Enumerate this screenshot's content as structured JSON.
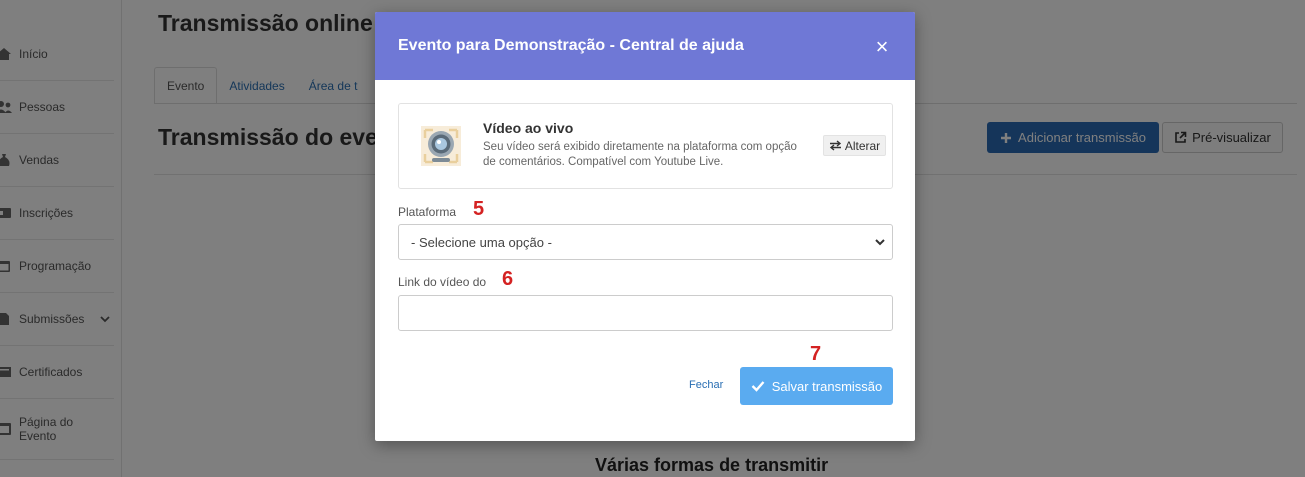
{
  "sidebar": {
    "items": [
      {
        "label": "Início",
        "icon": "home-icon"
      },
      {
        "label": "Pessoas",
        "icon": "people-icon"
      },
      {
        "label": "Vendas",
        "icon": "money-bag-icon"
      },
      {
        "label": "Inscrições",
        "icon": "id-card-icon"
      },
      {
        "label": "Programação",
        "icon": "calendar-icon"
      },
      {
        "label": "Submissões",
        "icon": "document-icon"
      },
      {
        "label": "Certificados",
        "icon": "certificate-icon"
      },
      {
        "label": "Página do Evento",
        "icon": "page-icon"
      }
    ]
  },
  "page": {
    "title": "Transmissão online",
    "tabs": [
      "Evento",
      "Atividades",
      "Área de t"
    ],
    "section_title": "Transmissão do evento",
    "add_button": "Adicionar transmissão",
    "preview_button": "Pré-visualizar",
    "bottom_heading": "Várias formas de transmitir"
  },
  "modal": {
    "title": "Evento para Demonstração - Central de ajuda",
    "close_symbol": "×",
    "type_card": {
      "title": "Vídeo ao vivo",
      "description": "Seu vídeo será exibido diretamente na plataforma com opção de comentários. Compatível com Youtube Live.",
      "change_button": "Alterar"
    },
    "platform": {
      "label": "Plataforma",
      "step": "5",
      "selected": "- Selecione uma opção -"
    },
    "video_link": {
      "label": "Link do vídeo do",
      "step": "6",
      "value": ""
    },
    "save_step": "7",
    "close_link": "Fechar",
    "save_button": "Salvar transmissão"
  },
  "colors": {
    "modal_header": "#6f78d6",
    "primary_button": "#2a6bb5",
    "save_button": "#5aabf0",
    "step_number": "#d42222",
    "link": "#2a6fb3"
  }
}
